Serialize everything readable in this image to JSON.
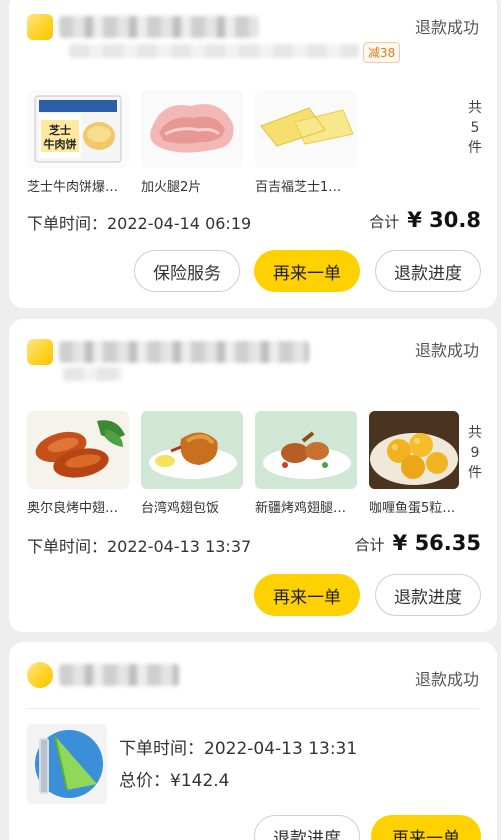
{
  "orders": [
    {
      "status": "退款成功",
      "promo": "减38",
      "items": [
        {
          "name": "芝士牛肉饼爆…",
          "box_text": "芝士\n牛肉饼"
        },
        {
          "name": "加火腿2片"
        },
        {
          "name": "百吉福芝士1…"
        }
      ],
      "count_chars": [
        "共",
        "5",
        "件"
      ],
      "order_time": "下单时间：2022-04-14 06:19",
      "total_label": "合计",
      "total_amount": "¥ 30.8",
      "buttons": [
        "保险服务",
        "再来一单",
        "退款进度"
      ]
    },
    {
      "status": "退款成功",
      "items": [
        {
          "name": "奥尔良烤中翅…"
        },
        {
          "name": "台湾鸡翅包饭"
        },
        {
          "name": "新疆烤鸡翅腿…"
        },
        {
          "name": "咖喱鱼蛋5粒…"
        }
      ],
      "count_chars": [
        "共",
        "9",
        "件"
      ],
      "order_time": "下单时间：2022-04-13 13:37",
      "total_label": "合计",
      "total_amount": "¥ 56.35",
      "buttons": [
        "再来一单",
        "退款进度"
      ]
    },
    {
      "status": "退款成功",
      "order_time": "下单时间：2022-04-13 13:31",
      "total_price": "总价：¥142.4",
      "buttons": [
        "退款进度",
        "再来一单"
      ]
    }
  ],
  "colors": {
    "accent": "#ffd100",
    "background": "#eeeeee",
    "card": "#ffffff"
  }
}
